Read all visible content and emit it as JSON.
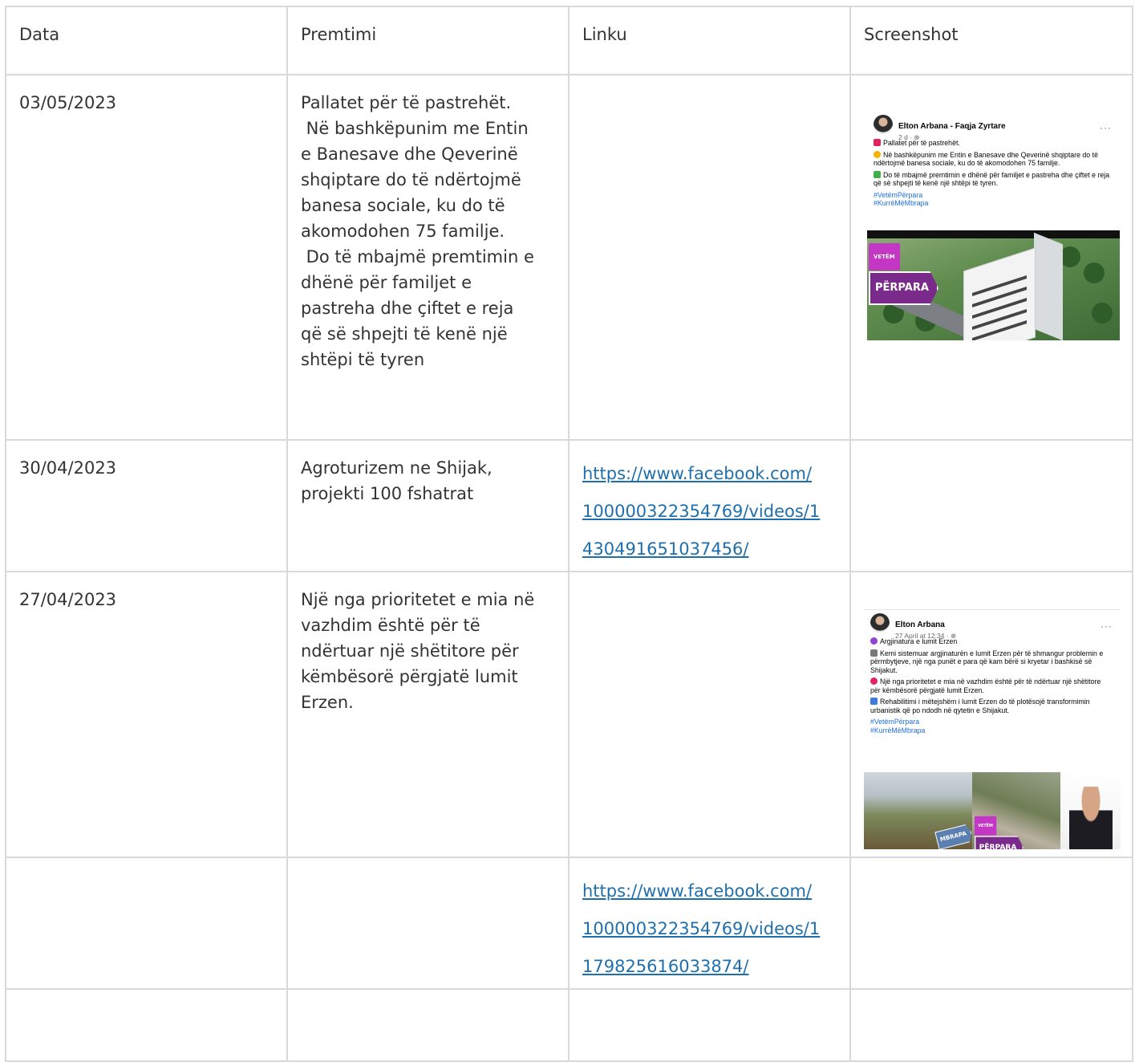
{
  "table": {
    "headers": [
      "Data",
      "Premtimi",
      "Linku",
      "Screenshot"
    ],
    "rows": [
      {
        "date": "03/05/2023",
        "promise_lines": [
          "Pallatet për të pastrehët.",
          " Në bashkëpunim me Entin",
          "e Banesave dhe Qeverinë",
          "shqiptare do të ndërtojmë",
          "banesa sociale, ku do të",
          "akomodohen 75 familje.",
          " Do të mbajmë premtimin e",
          "dhënë për familjet e",
          "pastreha dhe çiftet e reja",
          "që së shpejti të kenë një",
          "shtëpi të tyren"
        ],
        "link_lines": [],
        "screenshot": {
          "name": "Elton Arbana - Faqja Zyrtare",
          "meta": "2 d · ⊗",
          "more": "···",
          "paragraphs": [
            {
              "icon": "pushpin-icon",
              "icon_color": "#e0245e",
              "text": "Pallatet për të pastrehët."
            },
            {
              "icon": "handshake-icon",
              "icon_color": "#f4b400",
              "text": "Në bashkëpunim me Entin e Banesave dhe Qeverinë shqiptare do të ndërtojmë banesa sociale, ku do të akomodohen 75 familje."
            },
            {
              "icon": "check-icon",
              "icon_color": "#43b047",
              "text": "Do të mbajmë premtimin e dhënë për familjet e pastreha dhe çiftet e reja që së shpejti të kenë një shtëpi të tyren."
            }
          ],
          "tags": [
            "#VetëmPërpara",
            "#KurrëMëMbrapa"
          ],
          "badge_small": "VETËM",
          "badge_large": "PËRPARA"
        }
      },
      {
        "date": "30/04/2023",
        "promise_lines": [
          "Agroturizem ne Shijak,",
          "projekti 100 fshatrat"
        ],
        "link_lines": [
          "https://www.facebook.com/",
          "100000322354769/videos/1",
          "430491651037456/"
        ]
      },
      {
        "date": "27/04/2023",
        "promise_lines": [
          "Një nga prioritetet e mia në",
          "vazhdim është për të",
          "ndërtuar një shëtitore për",
          "këmbësorë përgjatë lumit",
          "Erzen."
        ],
        "link_lines": [],
        "screenshot": {
          "name": "Elton Arbana",
          "meta": "27 April at 12:34 · ⊗",
          "more": "···",
          "paragraphs": [
            {
              "icon": "purple-circle-icon",
              "icon_color": "#8e44d6",
              "text": "Argjinatura e lumit Erzen"
            },
            {
              "icon": "checkmark-icon",
              "icon_color": "#7a7a7a",
              "text": "Kemi sistemuar argjinaturën e lumit Erzen për të shmangur problemin e përmbytjeve, një nga punët e para që kam bërë si kryetar i bashkisë së Shijakut."
            },
            {
              "icon": "target-icon",
              "icon_color": "#e0245e",
              "text": "Një nga prioritetet e mia në vazhdim është për të ndërtuar një shëtitore për këmbësorë  përgjatë lumit Erzen."
            },
            {
              "icon": "landscape-icon",
              "icon_color": "#3b7dd8",
              "text": "Rehabilitimi i mëtejshëm i lumit Erzen do të plotësojë transformimin urbanistik që po ndodh në qytetin e Shijakut."
            }
          ],
          "tags": [
            "#VetëmPërpara",
            "#KurrëMëMbrapa"
          ],
          "badge_small": "VETËM",
          "badge_large": "PËRPARA",
          "badge2_large": "MBRAPA"
        }
      },
      {
        "date": "",
        "promise_lines": [],
        "link_lines": [
          "https://www.facebook.com/",
          "100000322354769/videos/1",
          "179825616033874/"
        ]
      },
      {
        "date": "",
        "promise_lines": [],
        "link_lines": []
      }
    ]
  }
}
